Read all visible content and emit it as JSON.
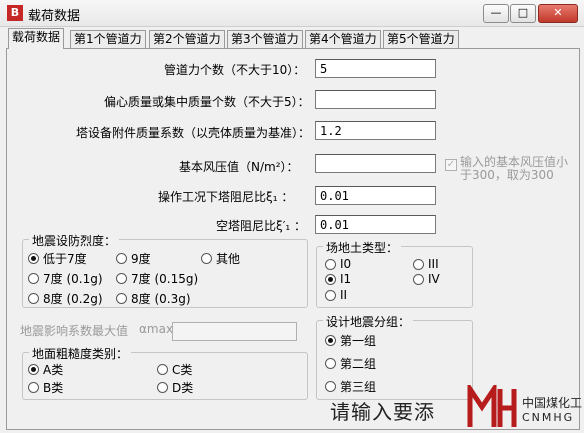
{
  "window": {
    "title": "载荷数据",
    "app_icon_letter": "B",
    "min_label": "—",
    "max_label": "□",
    "close_label": "✕"
  },
  "tabs": [
    {
      "label": "载荷数据",
      "active": true
    },
    {
      "label": "第1个管道力"
    },
    {
      "label": "第2个管道力"
    },
    {
      "label": "第3个管道力"
    },
    {
      "label": "第4个管道力"
    },
    {
      "label": "第5个管道力"
    }
  ],
  "form": {
    "pipe_force_count": {
      "label": "管道力个数（不大于10）：",
      "value": "5"
    },
    "eccentric_mass_count": {
      "label": "偏心质量或集中质量个数（不大于5）：",
      "value": ""
    },
    "attachment_mass_coef": {
      "label": "塔设备附件质量系数（以壳体质量为基准）：",
      "value": "1.2"
    },
    "basic_wind_pressure": {
      "label": "基本风压值（N/m²）：",
      "value": ""
    },
    "wind_note": {
      "line1": "输入的基本风压值小",
      "line2": "于300，取为300",
      "checked": true
    },
    "damping_operating": {
      "label": "操作工况下塔阻尼比ξ₁ ：",
      "value": "0.01"
    },
    "damping_empty": {
      "label": "空塔阻尼比ξ′₁ ：",
      "value": "0.01"
    },
    "seismic_coef_max": {
      "label": "地震影响系数最大值",
      "symbol": "αmax:",
      "value": ""
    }
  },
  "seismic_intensity": {
    "title": "地震设防烈度：",
    "options": [
      "低于7度",
      "9度",
      "其他",
      "7度 (0.1g)",
      "7度 (0.15g)",
      "8度 (0.2g)",
      "8度 (0.3g)"
    ],
    "selected": "低于7度"
  },
  "site_soil": {
    "title": "场地土类型：",
    "options": [
      "I0",
      "III",
      "I1",
      "IV",
      "II"
    ],
    "selected": "I1"
  },
  "seismic_group": {
    "title": "设计地震分组：",
    "options": [
      "第一组",
      "第二组",
      "第三组"
    ],
    "selected": "第一组"
  },
  "ground_roughness": {
    "title": "地面粗糙度类别：",
    "options": [
      "A类",
      "C类",
      "B类",
      "D类"
    ],
    "selected": "A类"
  },
  "overlay": {
    "prompt_text": "请输入要添",
    "logo_cn": "中国煤化工",
    "logo_en": "CNMHG"
  }
}
